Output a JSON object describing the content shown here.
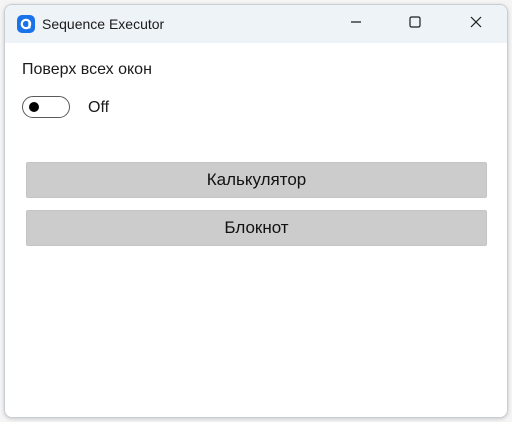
{
  "window": {
    "title": "Sequence Executor",
    "icon": "app-logo-icon",
    "controls": {
      "minimize_icon": "minimize-icon",
      "maximize_icon": "maximize-icon",
      "close_icon": "close-icon"
    }
  },
  "settings": {
    "topmost_label": "Поверх всех окон",
    "toggle_state": "Off",
    "toggle_on": false
  },
  "actions": [
    {
      "label": "Калькулятор"
    },
    {
      "label": "Блокнот"
    }
  ],
  "colors": {
    "titlebar_bg": "#eef3f8",
    "button_bg": "#cccccc",
    "app_icon_accent": "#1a73e8"
  }
}
